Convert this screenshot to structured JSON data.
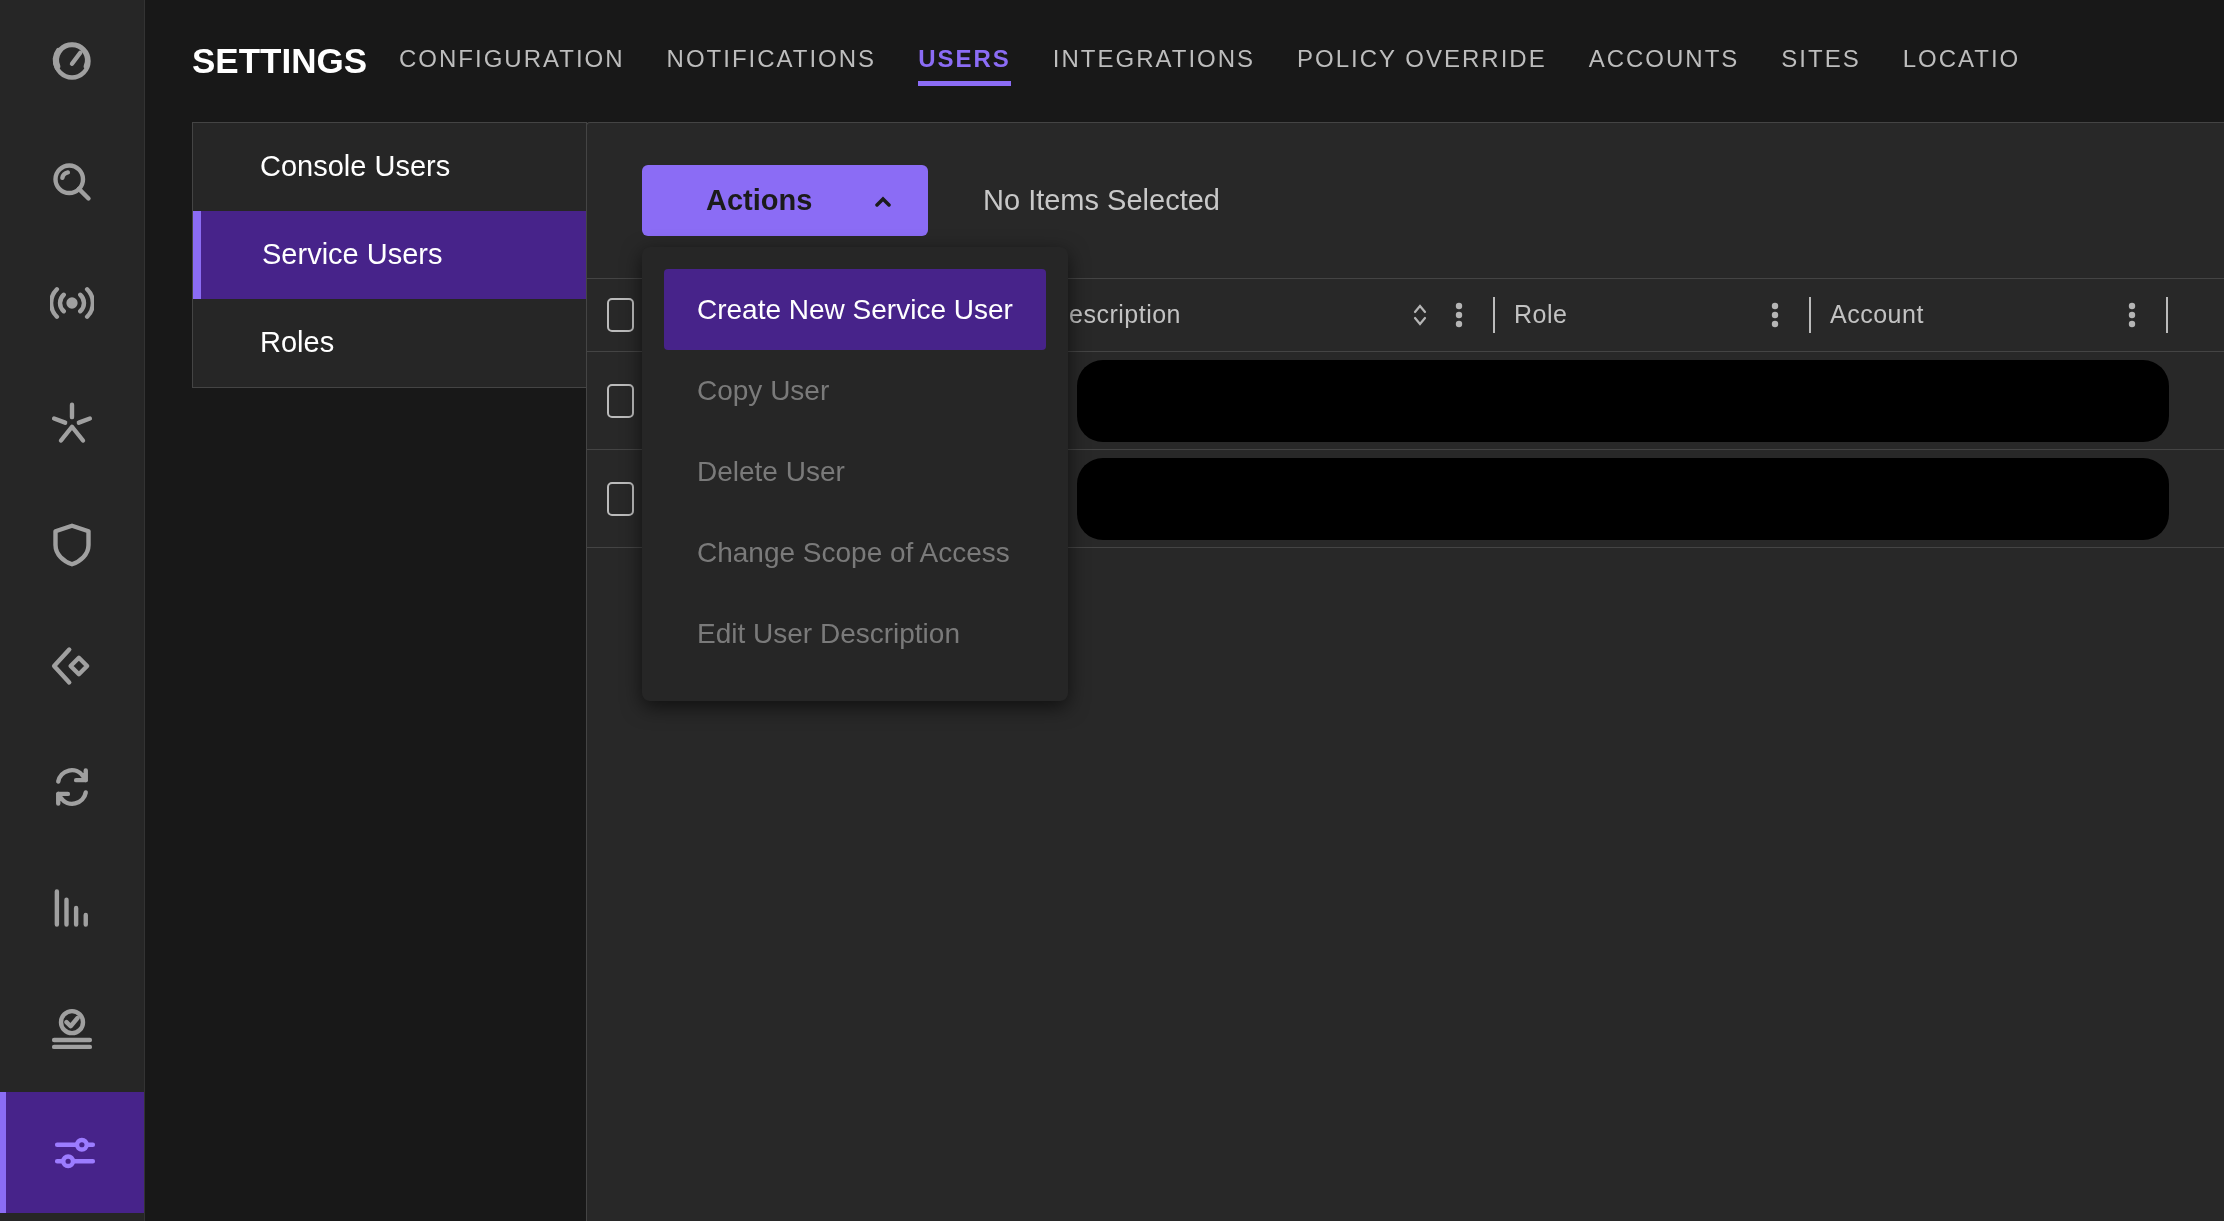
{
  "sidebar": {
    "items": [
      {
        "selected": false
      },
      {
        "selected": false
      },
      {
        "selected": false
      },
      {
        "selected": false
      },
      {
        "selected": false
      },
      {
        "selected": false
      },
      {
        "selected": false
      },
      {
        "selected": false
      },
      {
        "selected": false
      },
      {
        "selected": true
      }
    ]
  },
  "header": {
    "title": "SETTINGS",
    "tabs": [
      {
        "label": "CONFIGURATION",
        "selected": false
      },
      {
        "label": "NOTIFICATIONS",
        "selected": false
      },
      {
        "label": "USERS",
        "selected": true
      },
      {
        "label": "INTEGRATIONS",
        "selected": false
      },
      {
        "label": "POLICY OVERRIDE",
        "selected": false
      },
      {
        "label": "ACCOUNTS",
        "selected": false
      },
      {
        "label": "SITES",
        "selected": false
      },
      {
        "label": "LOCATIO",
        "selected": false
      }
    ]
  },
  "submenu": [
    {
      "label": "Console Users",
      "selected": false
    },
    {
      "label": "Service Users",
      "selected": true
    },
    {
      "label": "Roles",
      "selected": false
    }
  ],
  "toolbar": {
    "actions_button": "Actions",
    "selection_status": "No Items Selected"
  },
  "actions_menu": [
    {
      "label": "Create New Service User",
      "selected": true,
      "disabled": false
    },
    {
      "label": "Copy User",
      "selected": false,
      "disabled": true
    },
    {
      "label": "Delete User",
      "selected": false,
      "disabled": true
    },
    {
      "label": "Change Scope of Access",
      "selected": false,
      "disabled": true
    },
    {
      "label": "Edit User Description",
      "selected": false,
      "disabled": true
    }
  ],
  "table": {
    "header_checked": false,
    "columns": [
      {
        "label": "escription",
        "sortable": true
      },
      {
        "label": "Role",
        "sortable": false
      },
      {
        "label": "Account",
        "sortable": false
      }
    ],
    "rows": [
      {
        "checked": false,
        "redacted": true
      },
      {
        "checked": false,
        "redacted": true
      }
    ]
  }
}
